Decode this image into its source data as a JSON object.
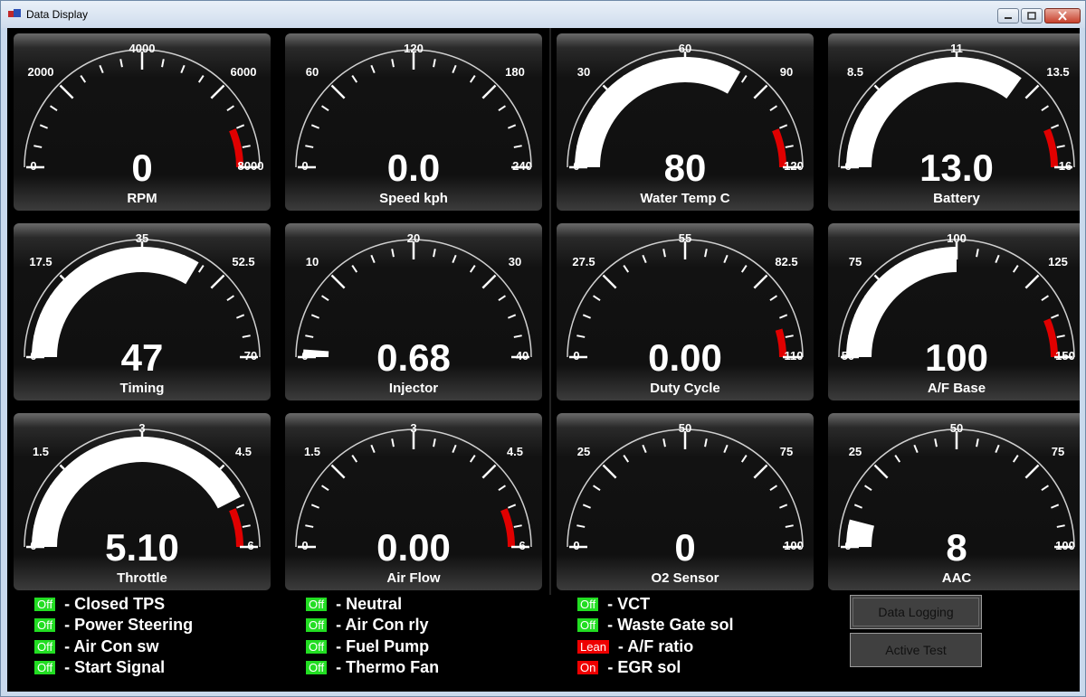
{
  "window": {
    "title": "Data Display"
  },
  "colors": {
    "green": "#22dd22",
    "red": "#ee0000",
    "panel": "#141414"
  },
  "gauges": [
    {
      "label": "RPM",
      "value_text": "0",
      "min": 0,
      "max": 8000,
      "ticks": [
        "0",
        "2000",
        "4000",
        "6000",
        "8000"
      ],
      "value": 0,
      "redline_from": 7000
    },
    {
      "label": "Speed kph",
      "value_text": "0.0",
      "min": 0,
      "max": 240,
      "ticks": [
        "0",
        "60",
        "120",
        "180",
        "240"
      ],
      "value": 0,
      "redline_from": null
    },
    {
      "label": "Water Temp C",
      "value_text": "80",
      "min": 0,
      "max": 120,
      "ticks": [
        "0",
        "30",
        "60",
        "90",
        "120"
      ],
      "value": 80,
      "redline_from": 105
    },
    {
      "label": "Battery",
      "value_text": "13.0",
      "min": 6,
      "max": 16,
      "ticks": [
        "6",
        "8.5",
        "11",
        "13.5",
        "16"
      ],
      "value": 13.0,
      "redline_from": 14.75
    },
    {
      "label": "Timing",
      "value_text": "47",
      "min": 0,
      "max": 70,
      "ticks": [
        "0",
        "17.5",
        "35",
        "52.5",
        "70"
      ],
      "value": 47,
      "redline_from": null
    },
    {
      "label": "Injector",
      "value_text": "0.68",
      "min": 0,
      "max": 40,
      "ticks": [
        "0",
        "10",
        "20",
        "30",
        "40"
      ],
      "value": 0.68,
      "redline_from": null
    },
    {
      "label": "Duty Cycle",
      "value_text": "0.00",
      "min": 0,
      "max": 110,
      "ticks": [
        "0",
        "27.5",
        "55",
        "82.5",
        "110"
      ],
      "value": 0,
      "redline_from": 100
    },
    {
      "label": "A/F Base",
      "value_text": "100",
      "min": 50,
      "max": 150,
      "ticks": [
        "50",
        "75",
        "100",
        "125",
        "150"
      ],
      "value": 100,
      "redline_from": 137.5
    },
    {
      "label": "Throttle",
      "value_text": "5.10",
      "min": 0,
      "max": 6,
      "ticks": [
        "0",
        "1.5",
        "3",
        "4.5",
        "6"
      ],
      "value": 5.1,
      "redline_from": 5.25
    },
    {
      "label": "Air Flow",
      "value_text": "0.00",
      "min": 0,
      "max": 6,
      "ticks": [
        "0",
        "1.5",
        "3",
        "4.5",
        "6"
      ],
      "value": 0,
      "redline_from": 5.25
    },
    {
      "label": "O2 Sensor",
      "value_text": "0",
      "min": 0,
      "max": 100,
      "ticks": [
        "0",
        "25",
        "50",
        "75",
        "100"
      ],
      "value": 0,
      "redline_from": null
    },
    {
      "label": "AAC",
      "value_text": "8",
      "min": 0,
      "max": 100,
      "ticks": [
        "0",
        "25",
        "50",
        "75",
        "100"
      ],
      "value": 8,
      "redline_from": null
    }
  ],
  "indicators": [
    {
      "state": "Off",
      "color": "green",
      "label": "- Closed TPS"
    },
    {
      "state": "Off",
      "color": "green",
      "label": "- Power Steering"
    },
    {
      "state": "Off",
      "color": "green",
      "label": "- Air Con sw"
    },
    {
      "state": "Off",
      "color": "green",
      "label": "- Start Signal"
    },
    {
      "state": "Off",
      "color": "green",
      "label": "- Neutral"
    },
    {
      "state": "Off",
      "color": "green",
      "label": "- Air Con rly"
    },
    {
      "state": "Off",
      "color": "green",
      "label": "- Fuel Pump"
    },
    {
      "state": "Off",
      "color": "green",
      "label": "- Thermo Fan"
    },
    {
      "state": "Off",
      "color": "green",
      "label": "- VCT"
    },
    {
      "state": "Off",
      "color": "green",
      "label": "- Waste Gate sol"
    },
    {
      "state": "Lean",
      "color": "red",
      "label": "- A/F ratio"
    },
    {
      "state": "On",
      "color": "red",
      "label": "- EGR sol"
    }
  ],
  "buttons": {
    "data_logging": "Data Logging",
    "active_test": "Active Test"
  }
}
